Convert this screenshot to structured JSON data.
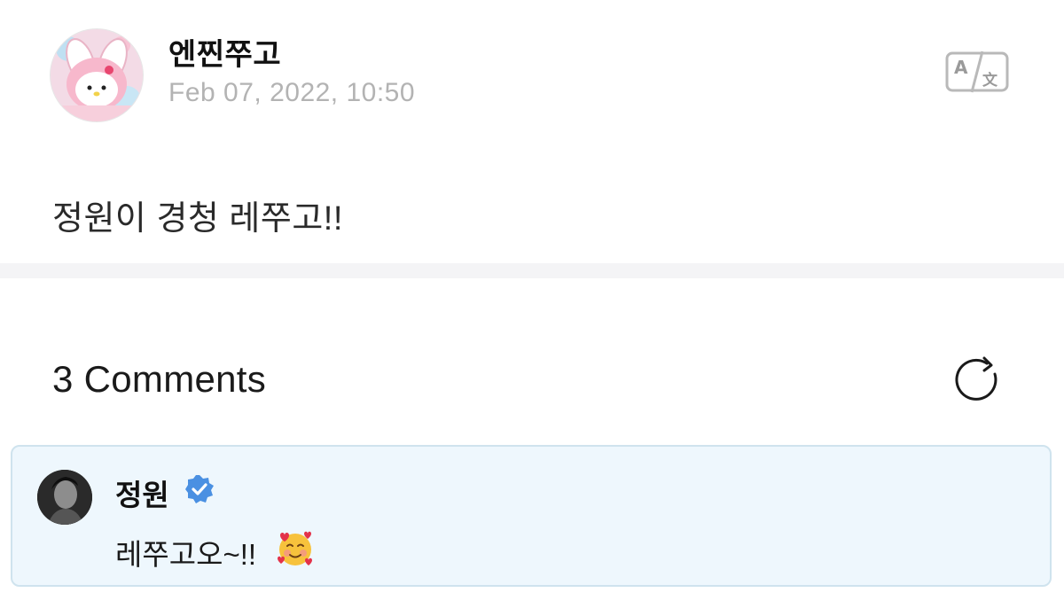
{
  "post": {
    "author": "엔찐쭈고",
    "date": "Feb 07, 2022, 10:50",
    "body": "정원이 경청 레쭈고!!",
    "avatar_icon": "my-melody-avatar",
    "translate_icon": "translate-icon"
  },
  "comments_section": {
    "title": "3 Comments",
    "refresh_icon": "refresh-icon"
  },
  "comments": [
    {
      "author": "정원",
      "verified": true,
      "verified_color": "#4a90e2",
      "text": "레쭈고오~!!",
      "emoji": "smiling-face-with-hearts"
    }
  ],
  "colors": {
    "comment_bg": "#eef7fd",
    "comment_border": "#cfe3ee",
    "divider": "#f4f4f6",
    "date_text": "#b3b3b3"
  }
}
